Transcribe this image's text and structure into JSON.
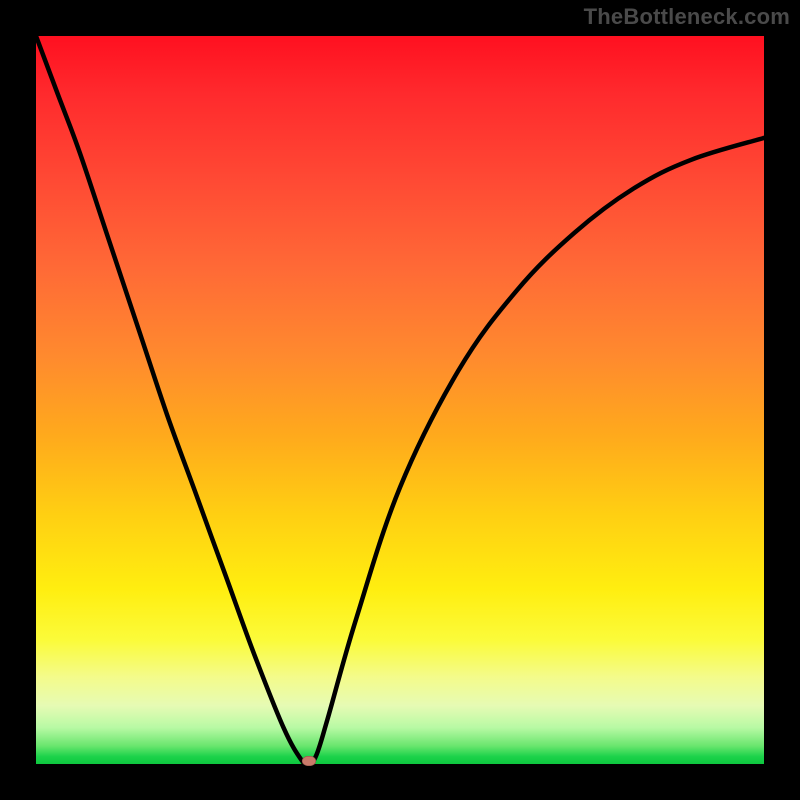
{
  "watermark": "TheBottleneck.com",
  "colors": {
    "frame": "#000000",
    "watermark_text": "#4a4a4a",
    "curve": "#000000",
    "marker": "#c97a6a"
  },
  "chart_data": {
    "type": "line",
    "title": "",
    "xlabel": "",
    "ylabel": "",
    "xlim": [
      0,
      1
    ],
    "ylim": [
      0,
      1
    ],
    "grid": false,
    "legend": false,
    "background_gradient": [
      {
        "stop": 0.0,
        "color": "#ff1020"
      },
      {
        "stop": 0.5,
        "color": "#ffb015"
      },
      {
        "stop": 0.8,
        "color": "#fff030"
      },
      {
        "stop": 0.95,
        "color": "#d5f9a0"
      },
      {
        "stop": 1.0,
        "color": "#0ec83f"
      }
    ],
    "series": [
      {
        "name": "bottleneck-curve",
        "x": [
          0.0,
          0.03,
          0.06,
          0.1,
          0.14,
          0.18,
          0.22,
          0.26,
          0.3,
          0.34,
          0.365,
          0.375,
          0.385,
          0.4,
          0.44,
          0.5,
          0.58,
          0.66,
          0.74,
          0.82,
          0.9,
          1.0
        ],
        "y": [
          1.0,
          0.92,
          0.84,
          0.72,
          0.6,
          0.48,
          0.37,
          0.26,
          0.15,
          0.05,
          0.005,
          0.0,
          0.012,
          0.06,
          0.2,
          0.38,
          0.54,
          0.65,
          0.73,
          0.79,
          0.83,
          0.86
        ]
      }
    ],
    "annotations": [
      {
        "type": "marker",
        "name": "minimum-point",
        "x": 0.375,
        "y": 0.0
      }
    ]
  }
}
